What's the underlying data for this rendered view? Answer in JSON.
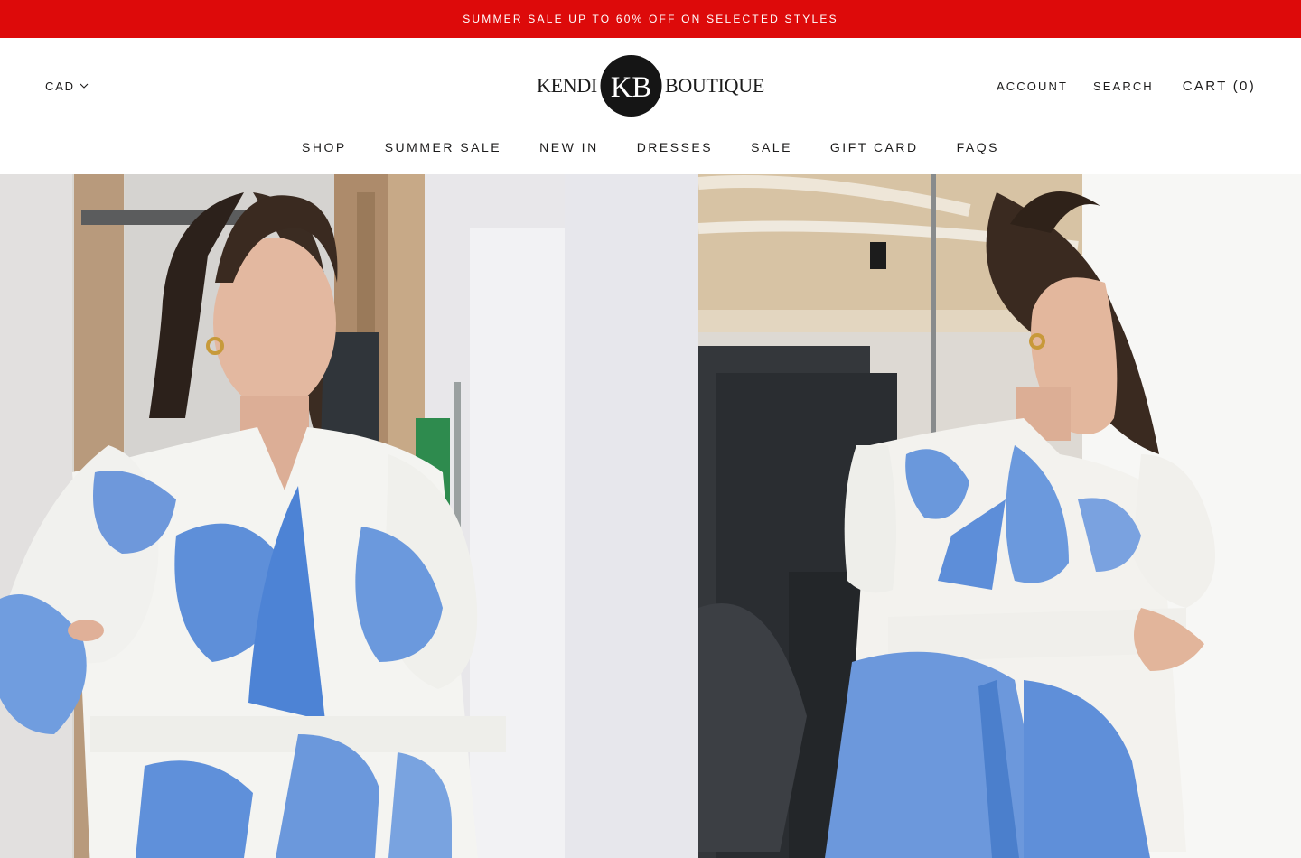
{
  "announcement": {
    "text": "SUMMER SALE UP TO 60% OFF ON SELECTED STYLES",
    "background": "#dd0a0a",
    "text_color": "#ffffff"
  },
  "header": {
    "currency": {
      "selected": "CAD",
      "icon": "chevron-down-icon"
    },
    "logo": {
      "left_text": "KENDI",
      "monogram": "KB",
      "right_text": "BOUTIQUE"
    },
    "links": {
      "account": "ACCOUNT",
      "search": "SEARCH",
      "cart": "CART (0)"
    }
  },
  "nav": {
    "items": [
      {
        "label": "SHOP"
      },
      {
        "label": "SUMMER SALE"
      },
      {
        "label": "NEW IN"
      },
      {
        "label": "DRESSES"
      },
      {
        "label": "SALE"
      },
      {
        "label": "GIFT CARD"
      },
      {
        "label": "FAQS"
      }
    ]
  },
  "gallery": {
    "images": [
      {
        "alt": "Model wearing white and blue floral puff-sleeve dress, front view"
      },
      {
        "alt": "Model wearing white and blue floral puff-sleeve dress, side view"
      }
    ]
  },
  "colors": {
    "text": "#1c1b1b",
    "dress_blue": "#5f8fd8",
    "dress_white": "#f4f4f1"
  }
}
